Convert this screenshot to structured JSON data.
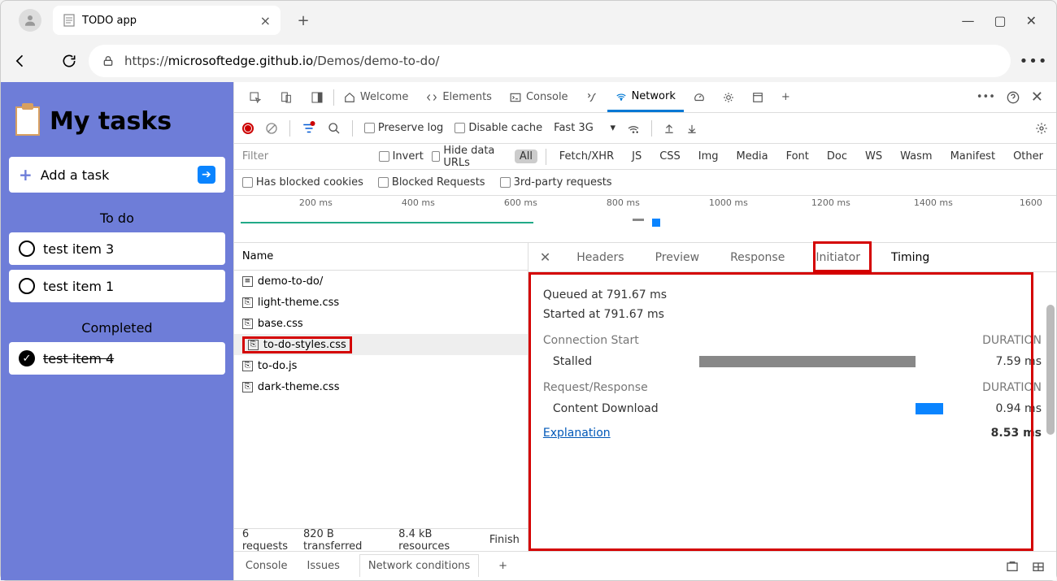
{
  "browser": {
    "tab_title": "TODO app",
    "url_prefix": "https://",
    "url_domain": "microsoftedge.github.io",
    "url_path": "/Demos/demo-to-do/"
  },
  "app": {
    "title": "My tasks",
    "add_placeholder": "Add a task",
    "sections": {
      "todo": "To do",
      "completed": "Completed"
    },
    "tasks_todo": [
      "test item 3",
      "test item 1"
    ],
    "tasks_done": [
      "test item 4"
    ]
  },
  "devtools": {
    "tabs": {
      "welcome": "Welcome",
      "elements": "Elements",
      "console": "Console",
      "network": "Network"
    },
    "toolbar": {
      "preserve": "Preserve log",
      "disable_cache": "Disable cache",
      "throttle": "Fast 3G"
    },
    "filters": {
      "placeholder": "Filter",
      "invert": "Invert",
      "hide_data": "Hide data URLs",
      "types": [
        "All",
        "Fetch/XHR",
        "JS",
        "CSS",
        "Img",
        "Media",
        "Font",
        "Doc",
        "WS",
        "Wasm",
        "Manifest",
        "Other"
      ],
      "blocked_cookies": "Has blocked cookies",
      "blocked_req": "Blocked Requests",
      "third_party": "3rd-party requests"
    },
    "timeline_labels": [
      "200 ms",
      "400 ms",
      "600 ms",
      "800 ms",
      "1000 ms",
      "1200 ms",
      "1400 ms",
      "1600"
    ],
    "files": {
      "header": "Name",
      "rows": [
        "demo-to-do/",
        "light-theme.css",
        "base.css",
        "to-do-styles.css",
        "to-do.js",
        "dark-theme.css"
      ],
      "selected_index": 3
    },
    "status": {
      "requests": "6 requests",
      "transferred": "820 B transferred",
      "resources": "8.4 kB resources",
      "finish": "Finish"
    },
    "detail_tabs": [
      "Headers",
      "Preview",
      "Response",
      "Initiator",
      "Timing"
    ],
    "timing": {
      "queued": "Queued at 791.67 ms",
      "started": "Started at 791.67 ms",
      "section_conn": "Connection Start",
      "section_req": "Request/Response",
      "duration_label": "DURATION",
      "stalled_label": "Stalled",
      "stalled_val": "7.59 ms",
      "download_label": "Content Download",
      "download_val": "0.94 ms",
      "explain": "Explanation",
      "total": "8.53 ms"
    },
    "drawer": {
      "console": "Console",
      "issues": "Issues",
      "netcond": "Network conditions"
    }
  }
}
